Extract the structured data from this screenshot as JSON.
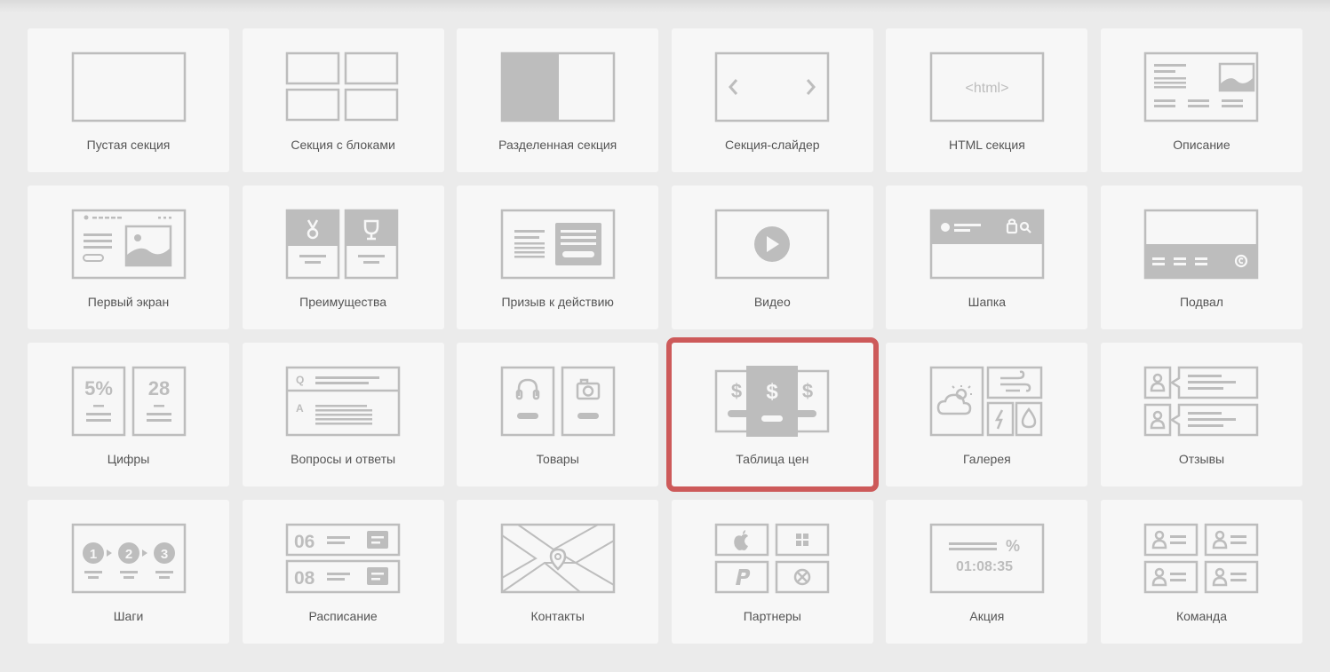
{
  "accent_selected": "#cd5a5a",
  "icon_color": "#bdbdbd",
  "sections": [
    {
      "label": "Пустая секция",
      "icon": "empty-section-icon"
    },
    {
      "label": "Секция с блоками",
      "icon": "blocks-section-icon"
    },
    {
      "label": "Разделенная секция",
      "icon": "split-section-icon"
    },
    {
      "label": "Секция-слайдер",
      "icon": "slider-section-icon"
    },
    {
      "label": "HTML секция",
      "icon": "html-section-icon",
      "icon_text": "<html>"
    },
    {
      "label": "Описание",
      "icon": "description-icon"
    },
    {
      "label": "Первый экран",
      "icon": "first-screen-icon"
    },
    {
      "label": "Преимущества",
      "icon": "advantages-icon"
    },
    {
      "label": "Призыв к действию",
      "icon": "call-to-action-icon"
    },
    {
      "label": "Видео",
      "icon": "video-icon"
    },
    {
      "label": "Шапка",
      "icon": "header-icon"
    },
    {
      "label": "Подвал",
      "icon": "footer-icon"
    },
    {
      "label": "Цифры",
      "icon": "numbers-icon",
      "icon_texts": [
        "5%",
        "28"
      ]
    },
    {
      "label": "Вопросы и ответы",
      "icon": "faq-icon",
      "icon_texts": [
        "Q",
        "A"
      ]
    },
    {
      "label": "Товары",
      "icon": "products-icon"
    },
    {
      "label": "Таблица цен",
      "icon": "pricing-table-icon",
      "selected": true
    },
    {
      "label": "Галерея",
      "icon": "gallery-icon"
    },
    {
      "label": "Отзывы",
      "icon": "reviews-icon"
    },
    {
      "label": "Шаги",
      "icon": "steps-icon",
      "icon_texts": [
        "1",
        "2",
        "3"
      ]
    },
    {
      "label": "Расписание",
      "icon": "schedule-icon",
      "icon_texts": [
        "06",
        "08"
      ]
    },
    {
      "label": "Контакты",
      "icon": "contacts-map-icon"
    },
    {
      "label": "Партнеры",
      "icon": "partners-icon"
    },
    {
      "label": "Акция",
      "icon": "promo-icon",
      "icon_texts": [
        "%",
        "01:08:35"
      ]
    },
    {
      "label": "Команда",
      "icon": "team-icon"
    }
  ]
}
